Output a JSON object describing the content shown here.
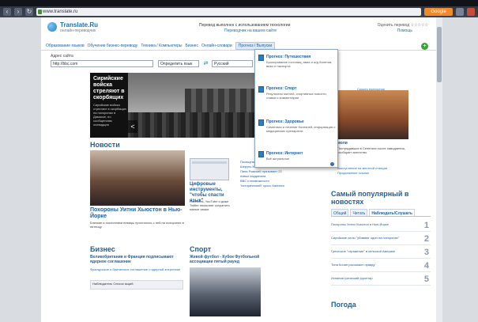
{
  "browser": {
    "url": "www.translate.ru",
    "extension_label": "Google"
  },
  "header": {
    "logo_name": "Translate.Ru",
    "logo_tagline": "онлайн-переводчик",
    "note": "Перевод выполнен с использованием технологии",
    "link": "Переводчик на вашем сайте",
    "rating": "Оценить перевод ☆☆☆☆☆",
    "help": "Помощь"
  },
  "nav": {
    "items": [
      "Образование языков",
      "Обучение бизнес-переводу",
      "Техника / Компьютеры",
      "Бизнес",
      "Онлайн-словари",
      "Прогноз / Выпуски"
    ],
    "plus": "+"
  },
  "translate": {
    "label": "Адрес сайта",
    "input_value": "http://bbc.com",
    "source_lang": "Определить язык",
    "target_lang": "Русский"
  },
  "hero": {
    "title": "Сирийские войска стреляют в скорбящих",
    "text": "Сирийские войска стреляют в скорбящих на похоронах в Дамаске, по сообщениям очевидцев",
    "arrow": "<"
  },
  "dropdown": {
    "items": [
      {
        "title": "Прогноз: Путешествия",
        "text": "Бронирование гостиниц, авиа и ж/д билетов, визы и паспорта"
      },
      {
        "title": "Прогноз: Спорт",
        "text": "Результаты матчей, спортивные новости, ставки и комментарии"
      },
      {
        "title": "Прогноз: Здоровье",
        "text": "Симптомы и лечение болезней, информация о медицинских препаратах"
      },
      {
        "title": "Прогноз: Интернет",
        "text": "Всё актуальное"
      }
    ]
  },
  "right": {
    "top_link": "Скрыть полностью",
    "caption": "моли",
    "caption_text": "Пострадавших в Сенегале после наводнения, сообщает агентство",
    "links": [
      "Выступление на местной станции",
      "Продолжение ссылки"
    ]
  },
  "news": {
    "heading": "Новости",
    "title": "Похороны Уитни Хьюстон в Нью-Йорке",
    "text": "Близкие и поклонники певицы простились с ней на похоронах в пятницу"
  },
  "middle": {
    "title": "Цифровые инструменты, \"чтобы спасти язык\"",
    "text": "Facebook, YouTube и даже Twitter помогают сохранить малые языки"
  },
  "side_list": {
    "items": [
      "Похищения: чтобы рассказать Шеруль Коля",
      "Папа Римский призывает 22 новых кардинала",
      "ВВС и возможности \"исторический\" кросс Калипсо"
    ]
  },
  "popular": {
    "heading": "Самый популярный в новостях",
    "tabs": [
      "Общий",
      "Читать",
      "Наблюдать/Слушать"
    ],
    "rows": [
      {
        "text": "Похороны Уитни Хьюстон в Нью-Йорке",
        "num": "1"
      },
      {
        "text": "Сирийские силы \"убивают один на похоронах\"",
        "num": "2"
      },
      {
        "text": "Греческое \"отражение\" в сельской Америке",
        "num": "3"
      },
      {
        "text": "Тина Кичин расскажет правду",
        "num": "4"
      },
      {
        "text": "Испания греческий фронтир",
        "num": "5"
      }
    ]
  },
  "weather": {
    "heading": "Погода"
  },
  "business": {
    "heading": "Бизнес",
    "title": "Великобритания и Франция подписывают ядерное соглашение",
    "text": "Французское и британское соглашение о ядерной энергетике",
    "box": "Наблюдатель Список акций"
  },
  "sport": {
    "heading": "Спорт",
    "title": "Живой футбол - Кубок Футбольной ассоциации пятый раунд"
  }
}
